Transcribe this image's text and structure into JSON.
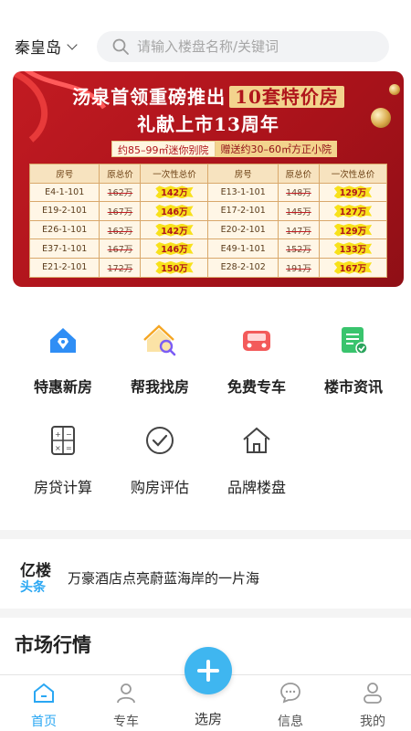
{
  "header": {
    "city": "秦皇岛",
    "search_placeholder": "请输入楼盘名称/关键词"
  },
  "banner": {
    "title_part1": "汤泉首领重磅推出",
    "title_highlight": "10套特价房",
    "title_line2": "礼献上市13周年",
    "sub_a": "约85–99㎡迷你别院",
    "sub_b": "赠送约30–60㎡方正小院",
    "table_headers": [
      "房号",
      "原总价",
      "一次性总价",
      "房号",
      "原总价",
      "一次性总价"
    ],
    "table_rows": [
      [
        "E4-1-101",
        "162万",
        "142万",
        "E13-1-101",
        "148万",
        "129万"
      ],
      [
        "E19-2-101",
        "167万",
        "146万",
        "E17-2-101",
        "145万",
        "127万"
      ],
      [
        "E26-1-101",
        "162万",
        "142万",
        "E20-2-101",
        "147万",
        "129万"
      ],
      [
        "E37-1-101",
        "167万",
        "146万",
        "E49-1-101",
        "152万",
        "133万"
      ],
      [
        "E21-2-101",
        "172万",
        "150万",
        "E28-2-102",
        "191万",
        "167万"
      ]
    ]
  },
  "features": {
    "row1": [
      "特惠新房",
      "帮我找房",
      "免费专车",
      "楼市资讯"
    ],
    "row2": [
      "房贷计算",
      "购房评估",
      "品牌楼盘"
    ]
  },
  "headline": {
    "logo_top": "亿楼",
    "logo_bottom": "头条",
    "text": "万豪酒店点亮蔚蓝海岸的一片海"
  },
  "market": {
    "title": "市场行情"
  },
  "tabbar": {
    "tabs": [
      "首页",
      "专车",
      "选房",
      "信息",
      "我的"
    ],
    "active": "首页",
    "active_color": "#2aa7f3"
  }
}
